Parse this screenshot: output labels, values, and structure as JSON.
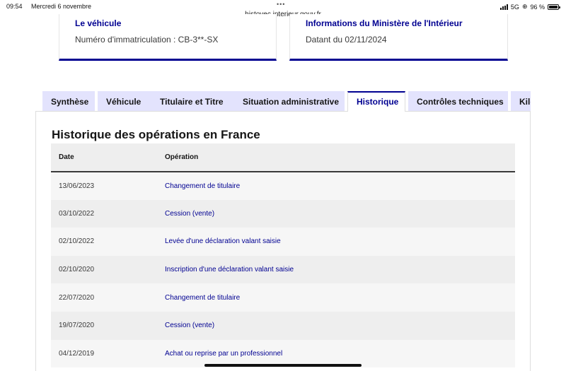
{
  "statusbar": {
    "time": "09:54",
    "date": "Mercredi 6 novembre",
    "url": "histovec.interieur.gouv.fr",
    "network": "5G",
    "battery": "96 %",
    "battery_level": 0.96
  },
  "cards": {
    "vehicle": {
      "title": "Le véhicule",
      "text": "Numéro d'immatriculation : CB-3**-SX"
    },
    "ministry": {
      "title": "Informations du Ministère de l'Intérieur",
      "text": "Datant du 02/11/2024"
    }
  },
  "tabs": [
    {
      "label": "Synthèse"
    },
    {
      "label": "Véhicule"
    },
    {
      "label": "Titulaire et Titre"
    },
    {
      "label": "Situation administrative"
    },
    {
      "label": "Historique",
      "active": true
    },
    {
      "label": "Contrôles techniques"
    },
    {
      "label": "Kilo"
    }
  ],
  "history": {
    "title": "Historique des opérations en France",
    "columns": {
      "date": "Date",
      "operation": "Opération"
    },
    "rows": [
      {
        "date": "13/06/2023",
        "operation": "Changement de titulaire"
      },
      {
        "date": "03/10/2022",
        "operation": "Cession (vente)"
      },
      {
        "date": "02/10/2022",
        "operation": "Levée d'une déclaration valant saisie"
      },
      {
        "date": "02/10/2020",
        "operation": "Inscription d'une déclaration valant saisie"
      },
      {
        "date": "22/07/2020",
        "operation": "Changement de titulaire"
      },
      {
        "date": "19/07/2020",
        "operation": "Cession (vente)"
      },
      {
        "date": "04/12/2019",
        "operation": "Achat ou reprise par un professionnel"
      }
    ]
  },
  "colors": {
    "brand_blue": "#000091",
    "tab_bg": "#e3e3fd"
  }
}
